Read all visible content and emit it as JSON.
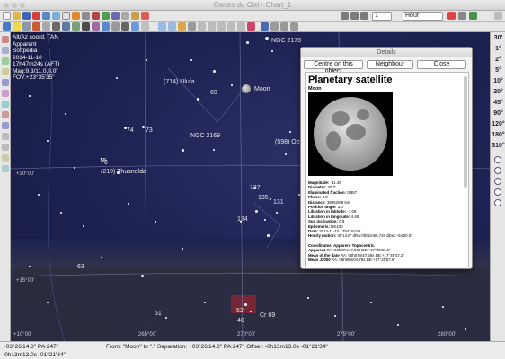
{
  "window": {
    "title": "Cartes du Ciel - Chart_1"
  },
  "toolbar": {
    "step_value": "1",
    "step_unit": "Hour"
  },
  "info_panel": {
    "line1": "Alt/Az coord. TAN",
    "line2": "Apparent",
    "line3": "Softpedia",
    "line4": "2014-11-10",
    "line5": "17h47m24s (AFT)",
    "line6": "Mag:9.3/11.0,8.0'",
    "line7": "FOV:+23°35'35\""
  },
  "sky_labels": {
    "ngc2175": "NGC 2175",
    "ufuta": "(714) Ulufa",
    "moon": "Moon",
    "n69": "69",
    "n74": "74",
    "n73": "73",
    "n76": "76",
    "ngc2169": "NGC 2169",
    "octavia": "(598) Octav",
    "n75": "75",
    "thusnelda": "(219) Thusnelda",
    "n137": "137",
    "n135": "135",
    "n131": "131",
    "n134": "134",
    "n63": "63",
    "n51": "51",
    "n52": "52",
    "cr69": "Cr 69",
    "n40": "40"
  },
  "grid_labels": {
    "dec20": "+20°00'",
    "dec15": "+15°00'",
    "dec10": "+10°00'",
    "ra265": "265°00'",
    "ra270": "270°00'",
    "ra275": "275°00'",
    "ra280": "280°00'"
  },
  "zoom_levels": [
    "30'",
    "1°",
    "2°",
    "5°",
    "10°",
    "20°",
    "45°",
    "90°",
    "120°",
    "180°",
    "310°"
  ],
  "details": {
    "title": "Details",
    "buttons": {
      "centre": "Centre on this object",
      "neighbour": "Neighbour",
      "close": "Close"
    },
    "heading": "Planetary satellite",
    "subheading": "Moon",
    "properties": [
      {
        "k": "Magnitude:",
        "v": " -11.38"
      },
      {
        "k": "Diameter:",
        "v": " 30.7'"
      },
      {
        "k": "Illuminated fraction:",
        "v": " 0.857"
      },
      {
        "k": "Phase:",
        "v": " 3.8"
      },
      {
        "k": "Distance:",
        "v": " 389528.8 km"
      },
      {
        "k": "Position angle:",
        "v": " 3.4"
      },
      {
        "k": "Libration in latitude:",
        "v": " -7.08"
      },
      {
        "k": "Libration in longitude:",
        "v": " 4.48"
      },
      {
        "k": "Sun inclination:",
        "v": " 0.9"
      },
      {
        "k": "Ephemeris:",
        "v": " DE430"
      },
      {
        "k": "Date:",
        "v": " 2014-11-10 17h47m24s"
      },
      {
        "k": "Hourly motion:",
        "v": " 30'14.8\" dRA:0h01m55.74s dDec:-04'20.5\""
      }
    ],
    "coords_heading": "Coordinates: Apparent Topocentric",
    "coords": [
      {
        "k": "Apparent",
        "v": " RA: 06h07m47.53s DE:+17°49'36.1\""
      },
      {
        "k": "Mean of the date",
        "v": " RA: 06h07m47.26s DE:+17°49'47.2\""
      },
      {
        "k": "Mean J2000",
        "v": " RA: 06h06m04.78s DE:+17°45'57.6\""
      }
    ]
  },
  "status": {
    "left_line1": "+03°26'14.8\" PA:247°",
    "left_line2": "-0h13m13.0s -01°21'34\"",
    "measure": "From: \"Moon\" to \".\" Separation: +03°26'14.8\" PA:247° Offset: -0h13m13.0s -01°21'34\""
  }
}
